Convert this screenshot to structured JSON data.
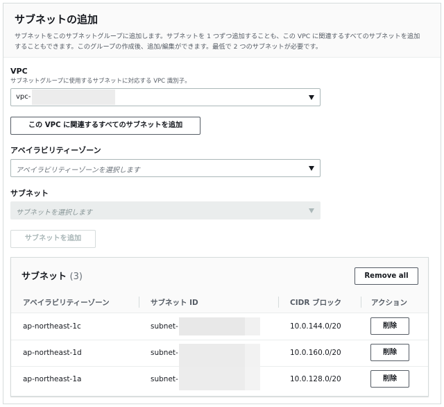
{
  "panel": {
    "title": "サブネットの追加",
    "description_line1": "サブネットをこのサブネットグループに追加します。サブネットを 1 つずつ追加することも、この VPC に関連するすべてのサブネットを追加",
    "description_line2": "することもできます。このグループの作成後、追加/編集ができます。最低で 2 つのサブネットが必要です。"
  },
  "vpc": {
    "label": "VPC",
    "sublabel": "サブネットグループに使用するサブネットに対応する VPC 識別子。",
    "value": "vpc-"
  },
  "add_all_button": "この VPC に関連するすべてのサブネットを追加",
  "az": {
    "label": "アベイラビリティーゾーン",
    "placeholder": "アベイラビリティーゾーンを選択します"
  },
  "subnet": {
    "label": "サブネット",
    "placeholder": "サブネットを選択します"
  },
  "add_subnet_button": "サブネットを追加",
  "table": {
    "title": "サブネット",
    "count": "(3)",
    "remove_all": "Remove all",
    "columns": [
      "アベイラビリティーゾーン",
      "サブネット ID",
      "CIDR ブロック",
      "アクション"
    ],
    "rows": [
      {
        "az": "ap-northeast-1c",
        "subnet_id": "subnet-",
        "cidr": "10.0.144.0/20",
        "action": "削除"
      },
      {
        "az": "ap-northeast-1d",
        "subnet_id": "subnet-",
        "cidr": "10.0.160.0/20",
        "action": "削除"
      },
      {
        "az": "ap-northeast-1a",
        "subnet_id": "subnet-",
        "cidr": "10.0.128.0/20",
        "action": "削除"
      }
    ]
  },
  "colors": {
    "border": "#d5dbdb",
    "header_bg": "#fafafa",
    "text": "#16191f",
    "secondary_text": "#545b64",
    "disabled_bg": "#eaeded"
  }
}
